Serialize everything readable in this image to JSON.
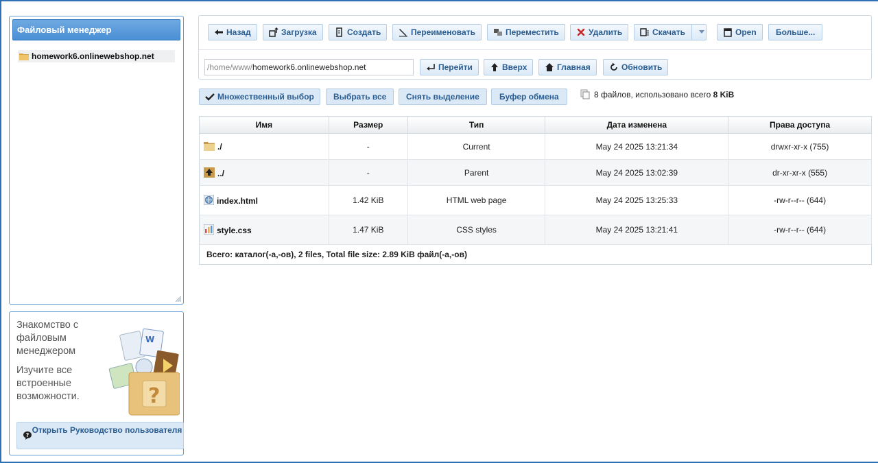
{
  "tree": {
    "title": "Файловый менеджер",
    "items": [
      {
        "label": "homework6.onlinewebshop.net",
        "icon": "folder-icon"
      }
    ]
  },
  "help": {
    "title": "Знакомство с файловым менеджером",
    "subtitle": "Изучите все встроенные возможности.",
    "button_label": "Открыть Руководство пользователя",
    "art_question_mark": "?"
  },
  "toolbar": {
    "back": "Назад",
    "upload": "Загрузка",
    "create": "Создать",
    "rename": "Переименовать",
    "move": "Переместить",
    "delete": "Удалить",
    "download": "Скачать",
    "open": "Open",
    "more": "Больше..."
  },
  "navbar": {
    "path_prefix": "/home/www/",
    "path_value": "homework6.onlinewebshop.net",
    "go": "Перейти",
    "up": "Вверх",
    "home": "Главная",
    "refresh": "Обновить"
  },
  "selection": {
    "multi": "Множественный выбор",
    "select_all": "Выбрать все",
    "deselect": "Снять выделение",
    "clipboard": "Буфер обмена",
    "status_prefix": "8 файлов, использовано всего ",
    "status_size": "8 KiB"
  },
  "table": {
    "headers": [
      "Имя",
      "Размер",
      "Тип",
      "Дата изменена",
      "Права доступа"
    ],
    "rows": [
      {
        "name": "./",
        "size": "-",
        "type": "Current",
        "date": "May 24 2025 13:21:34",
        "perms": "drwxr-xr-x (755)",
        "icon": "folder-icon"
      },
      {
        "name": "../",
        "size": "-",
        "type": "Parent",
        "date": "May 24 2025 13:02:39",
        "perms": "dr-xr-xr-x (555)",
        "icon": "parent-folder-icon"
      },
      {
        "name": "index.html",
        "size": "1.42 KiB",
        "type": "HTML web page",
        "date": "May 24 2025 13:25:33",
        "perms": "-rw-r--r-- (644)",
        "icon": "html-file-icon"
      },
      {
        "name": "style.css",
        "size": "1.47 KiB",
        "type": "CSS styles",
        "date": "May 24 2025 13:21:41",
        "perms": "-rw-r--r-- (644)",
        "icon": "css-file-icon"
      }
    ],
    "footer": "Всего:  каталог(-а,-ов), 2 files, Total file size: 2.89 KiB файл(-а,-ов)"
  },
  "colors": {
    "accent": "#2a5d91",
    "border": "#5b9bd5",
    "title_bar": "#4a8fd6",
    "delete": "#c62828"
  }
}
